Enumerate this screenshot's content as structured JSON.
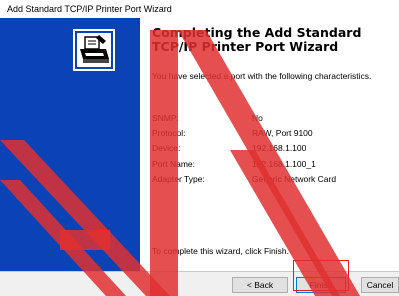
{
  "window": {
    "title": "Add Standard TCP/IP Printer Port Wizard"
  },
  "sidebar": {
    "icon": "printer-wizard-icon",
    "background": "#0b43b7"
  },
  "content": {
    "heading": "Completing the Add Standard TCP/IP Printer Port Wizard",
    "intro": "You have selected a port with the following characteristics.",
    "properties": [
      {
        "label": "SNMP:",
        "value": "No"
      },
      {
        "label": "Protocol:",
        "value": "RAW, Port 9100"
      },
      {
        "label": "Device:",
        "value": "192.168.1.100"
      },
      {
        "label": "Port Name:",
        "value": "192.168.1.100_1"
      },
      {
        "label": "Adapter Type:",
        "value": "Generic Network Card"
      }
    ],
    "footer": "To complete this wizard, click Finish."
  },
  "buttons": {
    "back": "< Back",
    "finish": "Finish",
    "cancel": "Cancel"
  },
  "colors": {
    "highlight": "#e02020",
    "watermark": "#e03030"
  }
}
